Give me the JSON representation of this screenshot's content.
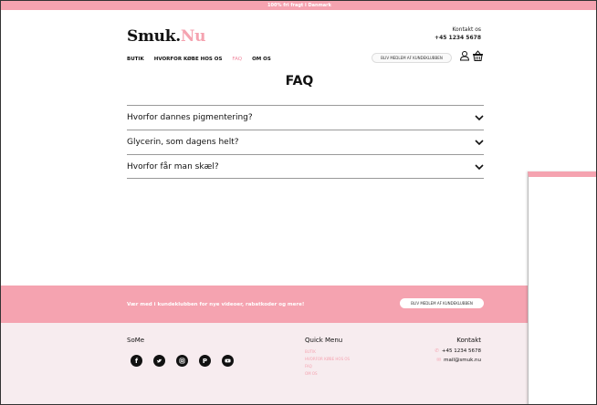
{
  "topbar": {
    "text": "100% fri fragt i Danmark"
  },
  "header": {
    "logo_main": "Smuk.",
    "logo_accent": "Nu",
    "contact_label": "Kontakt os",
    "contact_phone": "+45 1234 5678",
    "member_button": "BLIV MEDLEM AF KUNDEKLUBBEN"
  },
  "nav": {
    "items": [
      {
        "label": "BUTIK"
      },
      {
        "label": "HVORFOR KØBE HOS OS"
      },
      {
        "label": "FAQ"
      },
      {
        "label": "OM OS"
      }
    ]
  },
  "main": {
    "title": "FAQ",
    "faq": [
      {
        "question": "Hvorfor dannes pigmentering?"
      },
      {
        "question": "Glycerin, som dagens helt?"
      },
      {
        "question": "Hvorfor får man skæl?"
      }
    ]
  },
  "newsletter": {
    "text": "Vær med i kundeklubben for nye videoer, rabatkoder og mere!",
    "button": "BLIV MEDLEM AF KUNDEKLUBBEN"
  },
  "footer": {
    "some_title": "SoMe",
    "social_icons": [
      "facebook-icon",
      "twitter-icon",
      "instagram-icon",
      "pinterest-icon",
      "youtube-icon"
    ],
    "quick_menu_title": "Quick Menu",
    "quick_menu": [
      {
        "label": "BUTIK"
      },
      {
        "label": "HVORFOR KØBE HOS OS"
      },
      {
        "label": "FAQ"
      },
      {
        "label": "OM OS"
      }
    ],
    "kontakt_title": "Kontakt",
    "kontakt_phone": "+45 1234 5678",
    "kontakt_mail": "mail@smuk.nu"
  },
  "colors": {
    "accent": "#f5a3b0",
    "footer_bg": "#f7ecef"
  }
}
